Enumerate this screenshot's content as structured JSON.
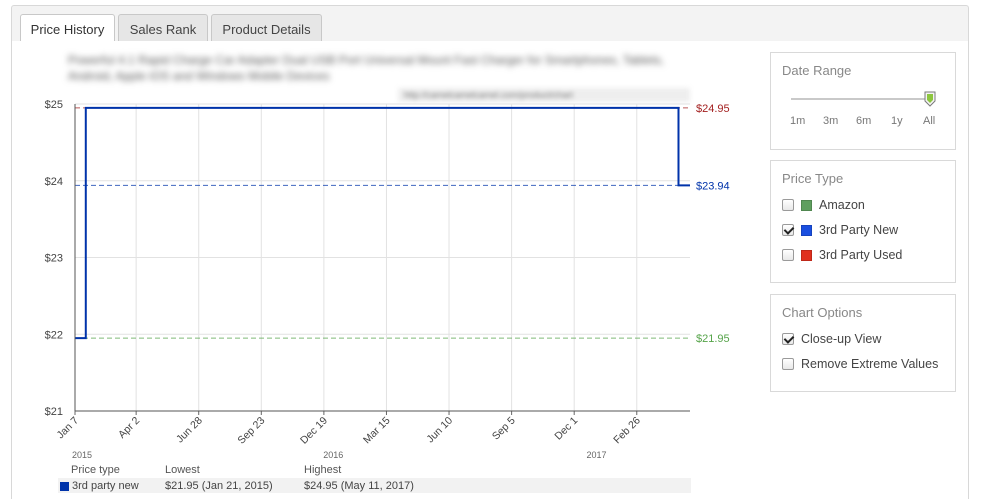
{
  "tabs": [
    {
      "label": "Price History",
      "active": true
    },
    {
      "label": "Sales Rank",
      "active": false
    },
    {
      "label": "Product Details",
      "active": false
    }
  ],
  "product": {
    "title_blurred": "Powerful 4.1 Rapid Charge Car Adapter Dual USB Port Universal Mount Fast Charger for Smartphones, Tablets, Android, Apple iOS and Windows Mobile Devices",
    "url_blurred": "http://camelcamelcamel.com/product/chart"
  },
  "chart_data": {
    "type": "line",
    "step": true,
    "x_start": "2015-01-07",
    "x_end": "2017-05-11",
    "ylim": [
      21,
      25
    ],
    "yticks": [
      {
        "label": "$25",
        "value": 25
      },
      {
        "label": "$24",
        "value": 24
      },
      {
        "label": "$23",
        "value": 23
      },
      {
        "label": "$22",
        "value": 22
      },
      {
        "label": "$21",
        "value": 21
      }
    ],
    "xticks": [
      {
        "label": "Jan 7",
        "date": "2015-01-07"
      },
      {
        "label": "Apr 2",
        "date": "2015-04-02"
      },
      {
        "label": "Jun 28",
        "date": "2015-06-28"
      },
      {
        "label": "Sep 23",
        "date": "2015-09-23"
      },
      {
        "label": "Dec 19",
        "date": "2015-12-19"
      },
      {
        "label": "Mar 15",
        "date": "2016-03-15"
      },
      {
        "label": "Jun 10",
        "date": "2016-06-10"
      },
      {
        "label": "Sep 5",
        "date": "2016-09-05"
      },
      {
        "label": "Dec 1",
        "date": "2016-12-01"
      },
      {
        "label": "Feb 26",
        "date": "2017-02-26"
      }
    ],
    "year_labels": [
      {
        "label": "2015",
        "date": "2015-01-07"
      },
      {
        "label": "2016",
        "date": "2016-01-01"
      },
      {
        "label": "2017",
        "date": "2017-01-01"
      }
    ],
    "grid": true,
    "series": [
      {
        "name": "3rd party new",
        "color": "#0033aa",
        "points": [
          {
            "date": "2015-01-07",
            "value": 21.95
          },
          {
            "date": "2015-01-21",
            "value": 21.95
          },
          {
            "date": "2015-01-22",
            "value": 24.95
          },
          {
            "date": "2017-04-24",
            "value": 24.95
          },
          {
            "date": "2017-04-25",
            "value": 23.94
          },
          {
            "date": "2017-05-11",
            "value": 23.94
          }
        ]
      }
    ],
    "reference_lines": [
      {
        "label": "$24.95",
        "value": 24.95,
        "color": "#a31f1f"
      },
      {
        "label": "$23.94",
        "value": 23.94,
        "color": "#0033aa"
      },
      {
        "label": "$21.95",
        "value": 21.95,
        "color": "#56a44a"
      }
    ],
    "legend": {
      "headers": [
        "Price type",
        "Lowest",
        "Highest"
      ],
      "rows": [
        {
          "name": "3rd party new",
          "lowest": "$21.95 (Jan 21, 2015)",
          "highest": "$24.95 (May 11, 2017)"
        }
      ]
    }
  },
  "date_range": {
    "title": "Date Range",
    "options": [
      "1m",
      "3m",
      "6m",
      "1y",
      "All"
    ],
    "selected": "All"
  },
  "price_type": {
    "title": "Price Type",
    "items": [
      {
        "label": "Amazon",
        "checked": false,
        "color": "#5f9f5f"
      },
      {
        "label": "3rd Party New",
        "checked": true,
        "color": "#1a4fe0"
      },
      {
        "label": "3rd Party Used",
        "checked": false,
        "color": "#e0301e"
      }
    ]
  },
  "chart_options": {
    "title": "Chart Options",
    "items": [
      {
        "label": "Close-up View",
        "checked": true
      },
      {
        "label": "Remove Extreme Values",
        "checked": false
      }
    ]
  }
}
